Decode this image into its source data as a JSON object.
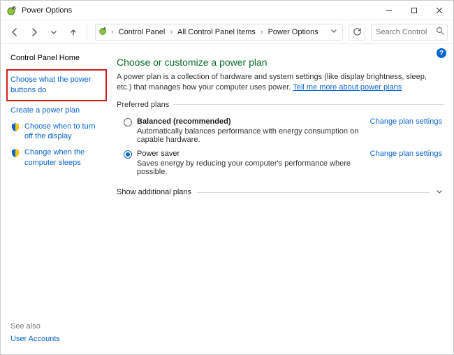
{
  "title": "Power Options",
  "window_controls": {
    "min": "minimize",
    "max": "maximize",
    "close": "close"
  },
  "nav": {
    "back": "Back",
    "forward": "Forward",
    "up": "Up",
    "refresh": "Refresh"
  },
  "breadcrumb": {
    "items": [
      "Control Panel",
      "All Control Panel Items",
      "Power Options"
    ]
  },
  "search": {
    "placeholder": "Search Control P..."
  },
  "help_tip": "?",
  "sidebar": {
    "home": "Control Panel Home",
    "links": [
      {
        "label": "Choose what the power buttons do",
        "highlighted": true
      },
      {
        "label": "Create a power plan",
        "highlighted": false
      }
    ],
    "sys_links": [
      "Choose when to turn off the display",
      "Change when the computer sleeps"
    ],
    "see_also_label": "See also",
    "see_also_links": [
      "User Accounts"
    ]
  },
  "main": {
    "heading": "Choose or customize a power plan",
    "desc_pre": "A power plan is a collection of hardware and system settings (like display brightness, sleep, etc.) that manages how your computer uses power. ",
    "desc_link": "Tell me more about power plans",
    "preferred_label": "Preferred plans",
    "plans": [
      {
        "name": "Balanced (recommended)",
        "desc": "Automatically balances performance with energy consumption on capable hardware.",
        "selected": false,
        "bold": true,
        "change_label": "Change plan settings"
      },
      {
        "name": "Power saver",
        "desc": "Saves energy by reducing your computer's performance where possible.",
        "selected": true,
        "bold": false,
        "change_label": "Change plan settings"
      }
    ],
    "show_more": "Show additional plans"
  }
}
